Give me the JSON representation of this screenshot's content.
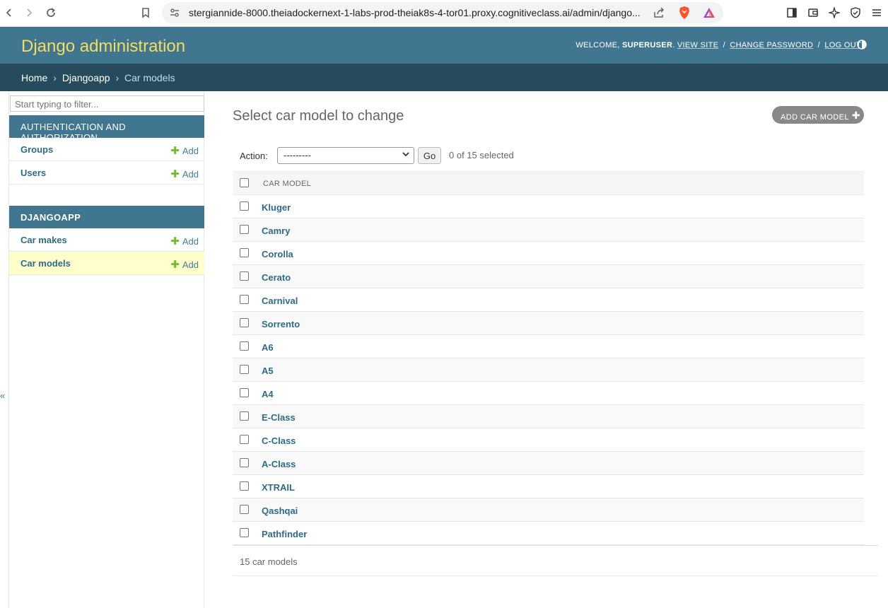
{
  "browser": {
    "url": "stergiannide-8000.theiadockernext-1-labs-prod-theiak8s-4-tor01.proxy.cognitiveclass.ai/admin/django..."
  },
  "header": {
    "branding": "Django administration",
    "welcome": "WELCOME,",
    "username": "SUPERUSER",
    "view_site": "VIEW SITE",
    "change_password": "CHANGE PASSWORD",
    "log_out": "LOG OUT",
    "sep": "/",
    "period": "."
  },
  "breadcrumbs": {
    "home": "Home",
    "app": "Djangoapp",
    "current": "Car models",
    "arrow": "›"
  },
  "sidebar": {
    "filter_placeholder": "Start typing to filter...",
    "add_label": "Add",
    "modules": [
      {
        "caption": "AUTHENTICATION AND AUTHORIZATION",
        "items": [
          "Groups",
          "Users"
        ]
      },
      {
        "caption": "DJANGOAPP",
        "items": [
          "Car makes",
          "Car models"
        ]
      }
    ],
    "collapse": "«"
  },
  "content": {
    "title": "Select car model to change",
    "add_button": "ADD CAR MODEL",
    "action_label": "Action:",
    "action_selected": "---------",
    "go_label": "Go",
    "counter": "0 of 15 selected",
    "column_header": "CAR MODEL",
    "rows": [
      "Kluger",
      "Camry",
      "Corolla",
      "Cerato",
      "Carnival",
      "Sorrento",
      "A6",
      "A5",
      "A4",
      "E-Class",
      "C-Class",
      "A-Class",
      "XTRAIL",
      "Qashqai",
      "Pathfinder"
    ],
    "paginator": "15 car models"
  },
  "colors": {
    "header_bg": "#417690",
    "breadcrumb_bg": "#264b5d",
    "branding": "#f5dd5d",
    "link": "#447e9b",
    "add_plus": "#70bf2b",
    "current_row": "#ffffcc"
  }
}
